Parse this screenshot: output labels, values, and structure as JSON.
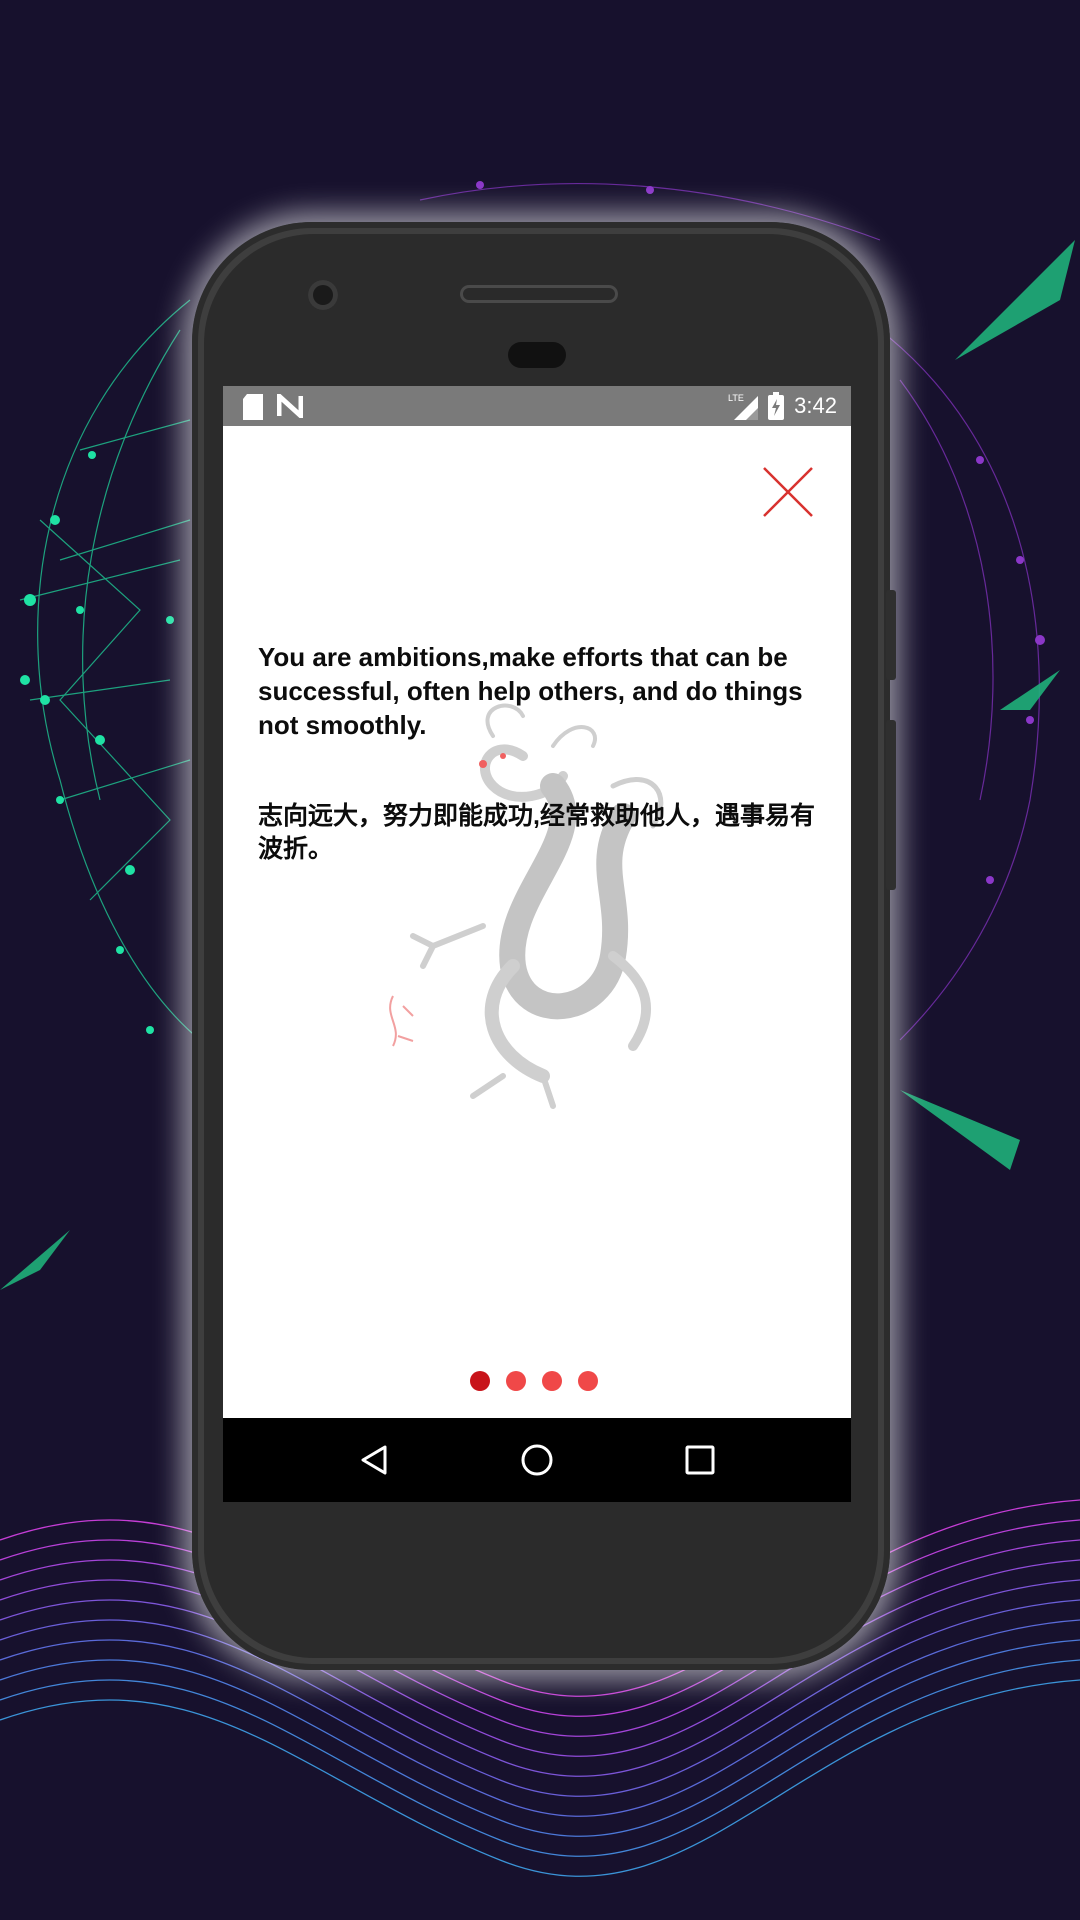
{
  "status_bar": {
    "left_icons": [
      "sd-card-icon",
      "n-notification-icon"
    ],
    "right_icons": [
      "lte-signal-icon",
      "battery-charging-icon"
    ],
    "lte_label": "LTE",
    "time": "3:42"
  },
  "message": {
    "english": "You are ambitions,make efforts that can be successful, often help others, and do things not smoothly.",
    "chinese": "志向远大，努力即能成功,经常救助他人，遇事易有波折。"
  },
  "pager": {
    "total": 4,
    "current": 1
  },
  "navigation": [
    "back-icon",
    "home-icon",
    "recents-icon"
  ],
  "colors": {
    "background": "#17112d",
    "close_icon": "#d8322f",
    "dot": "#f04848",
    "dot_active": "#c8141a"
  }
}
